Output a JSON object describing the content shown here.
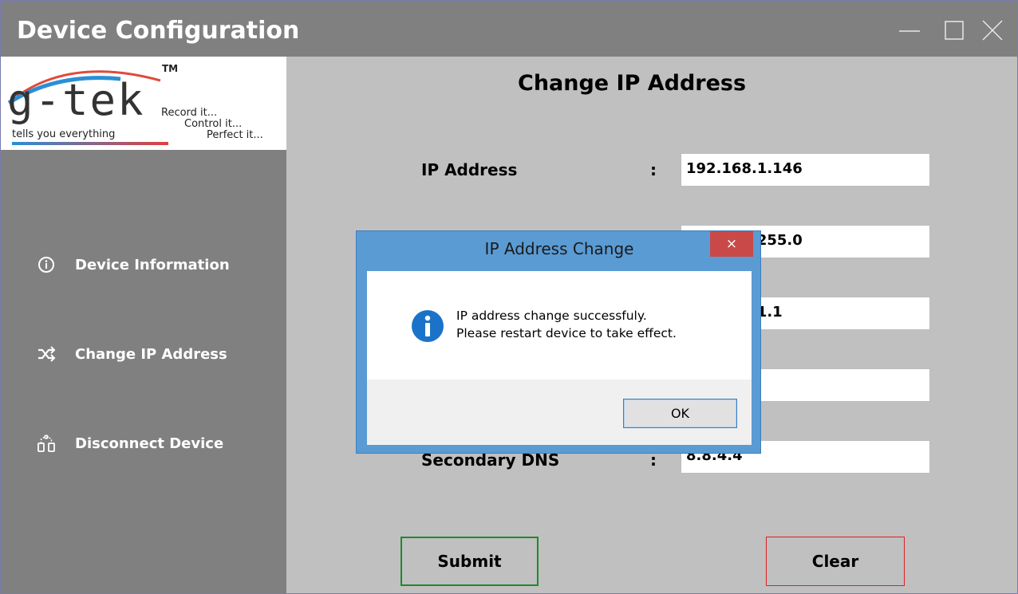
{
  "window": {
    "title": "Device Configuration"
  },
  "logo": {
    "brand": "g-tek",
    "tm": "TM",
    "tagline": "tells you everything",
    "record": "Record it...",
    "control": "Control it...",
    "perfect": "Perfect it..."
  },
  "sidebar": {
    "items": [
      {
        "label": "Device Information",
        "icon": "info-circle-icon"
      },
      {
        "label": "Change IP Address",
        "icon": "shuffle-icon"
      },
      {
        "label": "Disconnect Device",
        "icon": "disconnect-icon"
      }
    ]
  },
  "main": {
    "title": "Change IP Address",
    "fields": [
      {
        "label": "IP Address",
        "colon": ":",
        "value": "192.168.1.146"
      },
      {
        "label": "",
        "colon": "",
        "value": "255.255.255.0"
      },
      {
        "label": "",
        "colon": "",
        "value": "192.168.1.1"
      },
      {
        "label": "",
        "colon": "",
        "value": ""
      },
      {
        "label": "Secondary DNS",
        "colon": ":",
        "value": "8.8.4.4"
      }
    ],
    "submit_label": "Submit",
    "clear_label": "Clear"
  },
  "dialog": {
    "title": "IP Address Change",
    "close_label": "×",
    "message_line1": "IP address change successfuly.",
    "message_line2": "Please restart device to take effect.",
    "ok_label": "OK"
  },
  "colors": {
    "titlebar": "#808080",
    "sidebar": "#808080",
    "main_bg": "#c0c0c0",
    "dialog_frame": "#5a9bd4",
    "dialog_close": "#c94949",
    "info_icon": "#1a73c9",
    "submit_border": "#1f8a2a",
    "clear_border": "#e02020"
  }
}
